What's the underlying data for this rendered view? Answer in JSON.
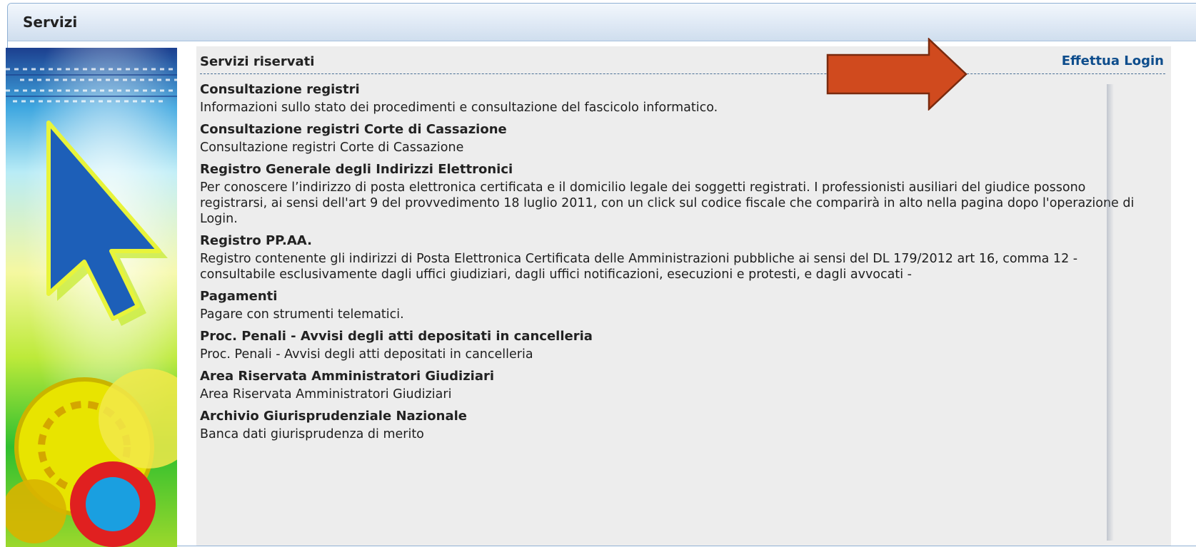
{
  "panel": {
    "title": "Servizi"
  },
  "content": {
    "section_title": "Servizi riservati",
    "login_label": "Effettua Login"
  },
  "services": [
    {
      "title": "Consultazione registri",
      "description": "Informazioni sullo stato dei procedimenti e consultazione del fascicolo informatico."
    },
    {
      "title": "Consultazione registri Corte di Cassazione",
      "description": "Consultazione registri Corte di Cassazione"
    },
    {
      "title": "Registro Generale degli Indirizzi Elettronici",
      "description": "Per conoscere l’indirizzo di posta elettronica certificata e il domicilio legale dei soggetti registrati. I professionisti ausiliari del giudice possono registrarsi, ai sensi dell'art 9 del provvedimento 18 luglio 2011, con un click sul codice fiscale che comparirà in alto nella pagina dopo l'operazione di Login."
    },
    {
      "title": "Registro PP.AA.",
      "description": "Registro contenente gli indirizzi di Posta Elettronica Certificata delle Amministrazioni pubbliche ai sensi del DL 179/2012 art 16, comma 12 - consultabile esclusivamente dagli uffici giudiziari, dagli uffici notificazioni, esecuzioni e protesti, e dagli avvocati -"
    },
    {
      "title": "Pagamenti",
      "description": "Pagare con strumenti telematici."
    },
    {
      "title": "Proc. Penali - Avvisi degli atti depositati in cancelleria",
      "description": "Proc. Penali - Avvisi degli atti depositati in cancelleria"
    },
    {
      "title": "Area Riservata Amministratori Giudiziari",
      "description": "Area Riservata Amministratori Giudiziari"
    },
    {
      "title": "Archivio Giurisprudenziale Nazionale",
      "description": "Banca dati giurisprudenza di merito"
    }
  ],
  "annotation": {
    "icon": "arrow-right-icon",
    "color": "#d04a1e"
  },
  "colors": {
    "link": "#0e4d8c",
    "content_bg": "#ededed",
    "header_border": "#8fb0d4"
  }
}
